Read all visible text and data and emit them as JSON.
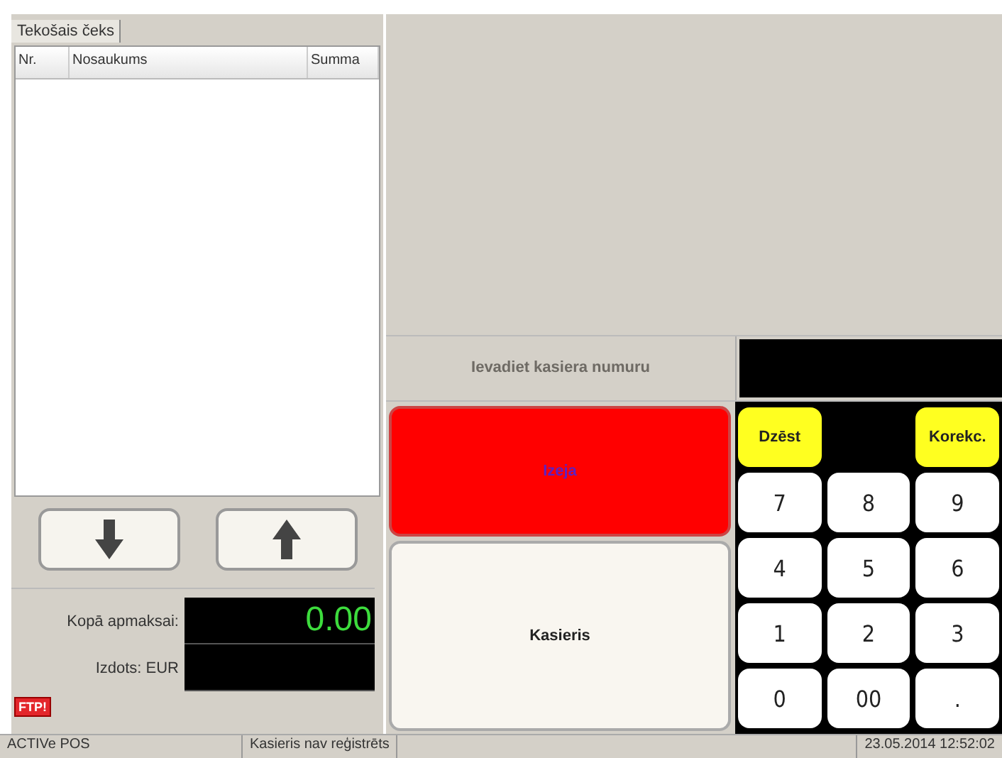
{
  "receipt": {
    "tab": {
      "label": "Tekošais čeks",
      "selected": true
    },
    "columns": [
      "Nr.",
      "Nosaukums",
      "Summa"
    ],
    "scroll_buttons": [
      {
        "kind": "down"
      },
      {
        "kind": "up"
      }
    ],
    "totals": [
      {
        "label": "Kopā apmaksai:",
        "value": "0.00"
      },
      {
        "label": "Izdots: EUR"
      }
    ],
    "badge": "FTP!"
  },
  "prompt": {
    "label": "Ievadiet kasiera numuru"
  },
  "actions": [
    {
      "label": "Izeja",
      "kind": "danger"
    },
    {
      "label": "Kasieris",
      "kind": "normal"
    }
  ],
  "keypad": [
    {
      "label": "Dzēst",
      "kind": "fn"
    },
    {
      "kind": "gap"
    },
    {
      "label": "Korekc.",
      "kind": "fn"
    },
    {
      "label": "7",
      "kind": "num"
    },
    {
      "label": "8",
      "kind": "num"
    },
    {
      "label": "9",
      "kind": "num"
    },
    {
      "label": "4",
      "kind": "num"
    },
    {
      "label": "5",
      "kind": "num"
    },
    {
      "label": "6",
      "kind": "num"
    },
    {
      "label": "1",
      "kind": "num"
    },
    {
      "label": "2",
      "kind": "num"
    },
    {
      "label": "3",
      "kind": "num"
    },
    {
      "label": "0",
      "kind": "num"
    },
    {
      "label": "00",
      "kind": "num"
    },
    {
      "label": ".",
      "kind": "num"
    }
  ],
  "status_bar": [
    "ACTIVe POS",
    "Kasieris nav reģistrēts",
    "23.05.2014 12:52:02"
  ]
}
